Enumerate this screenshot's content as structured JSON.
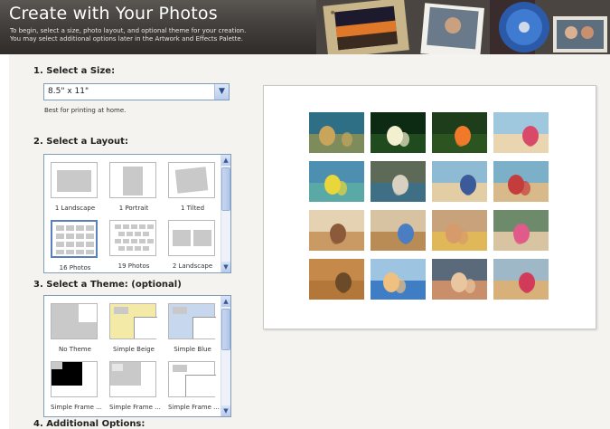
{
  "header": {
    "title": "Create with Your Photos",
    "subtitle_line1": "To begin, select a size, photo layout, and optional theme for your creation.",
    "subtitle_line2": "You may select additional options later in the Artwork and Effects Palette."
  },
  "size": {
    "heading": "1. Select a Size:",
    "value": "8.5\" x 11\"",
    "hint": "Best for printing at home."
  },
  "layout": {
    "heading": "2. Select a Layout:",
    "items": [
      {
        "label": "1 Landscape"
      },
      {
        "label": "1 Portrait"
      },
      {
        "label": "1 Tilted"
      },
      {
        "label": "16 Photos",
        "selected": true
      },
      {
        "label": "19 Photos"
      },
      {
        "label": "2 Landscape"
      }
    ]
  },
  "theme": {
    "heading": "3. Select a Theme: (optional)",
    "items": [
      {
        "label": "No Theme",
        "color": "#c9c9c9"
      },
      {
        "label": "Simple Beige",
        "color": "#f3eaa8"
      },
      {
        "label": "Simple Blue",
        "color": "#c7d8ee"
      },
      {
        "label": "Simple Frame ...",
        "color": "#000000"
      },
      {
        "label": "Simple Frame ...",
        "color": "#c9c9c9"
      },
      {
        "label": "Simple Frame ...",
        "color": "#ffffff"
      }
    ]
  },
  "options": {
    "heading": "4. Additional Options:"
  },
  "icons": {
    "dropdown": "chevron-down-icon",
    "scroll_up": "chevron-up-icon",
    "scroll_down": "chevron-down-icon"
  },
  "preview": {
    "photos": [
      {
        "sky": "#2e6f86",
        "ground": "#7d8c5a",
        "subject": "#c9a55c"
      },
      {
        "sky": "#0d2a12",
        "ground": "#1f4b1f",
        "subject": "#f3f0d0"
      },
      {
        "sky": "#1e3d1a",
        "ground": "#2c5420",
        "subject": "#f07a2a"
      },
      {
        "sky": "#9fc7de",
        "ground": "#e9d6b0",
        "subject": "#d94a6a"
      },
      {
        "sky": "#4d8fb0",
        "ground": "#5aa9a6",
        "subject": "#e8d63a"
      },
      {
        "sky": "#5e6a58",
        "ground": "#3f6f85",
        "subject": "#d8d0c0"
      },
      {
        "sky": "#8fbad3",
        "ground": "#e3cda5",
        "subject": "#3b5a9a"
      },
      {
        "sky": "#7cb0c9",
        "ground": "#d8b98a",
        "subject": "#c43c3c"
      },
      {
        "sky": "#e5d2b2",
        "ground": "#c99a64",
        "subject": "#8b5a3a"
      },
      {
        "sky": "#d7c3a1",
        "ground": "#b98c55",
        "subject": "#4a7ec2"
      },
      {
        "sky": "#c7a27a",
        "ground": "#e0b85a",
        "subject": "#d79a6a"
      },
      {
        "sky": "#6d8a6a",
        "ground": "#d9c4a2",
        "subject": "#e05a8a"
      },
      {
        "sky": "#c58a4a",
        "ground": "#b4773a",
        "subject": "#6b4a2a"
      },
      {
        "sky": "#9dc4e0",
        "ground": "#3f7ec5",
        "subject": "#f0c080"
      },
      {
        "sky": "#5a6a7a",
        "ground": "#c98f6a",
        "subject": "#e9c6a0"
      },
      {
        "sky": "#9fb8c8",
        "ground": "#d8b07a",
        "subject": "#d23b5a"
      }
    ]
  }
}
